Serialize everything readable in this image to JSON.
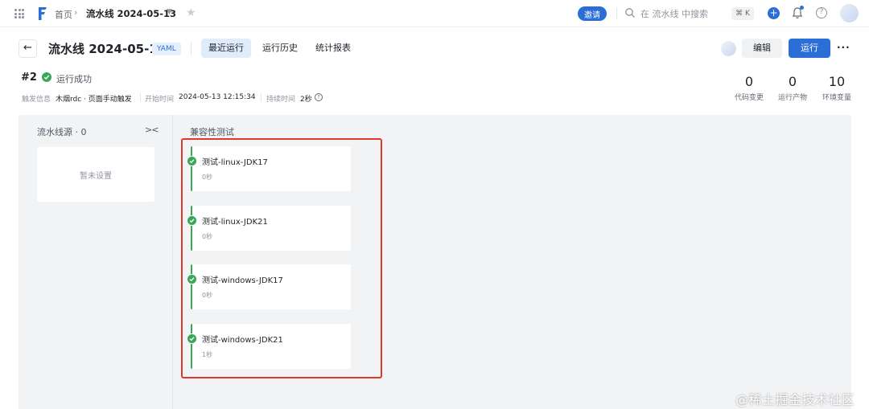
{
  "topbar": {
    "breadcrumb_home": "首页",
    "breadcrumb_sep": "›",
    "breadcrumb_current": "流水线 2024-05-13",
    "invite_label": "邀请",
    "search_placeholder": "在 流水线 中搜索",
    "shortcut": "⌘ K",
    "plus_label": "+",
    "help_label": "?",
    "brand_color": "#2b6fd6"
  },
  "header": {
    "back_label": "←",
    "title": "流水线 2024-05-13",
    "badge": "YAML",
    "tabs": [
      {
        "label": "最近运行",
        "active": true
      },
      {
        "label": "运行历史",
        "active": false
      },
      {
        "label": "统计报表",
        "active": false
      }
    ],
    "edit_label": "编辑",
    "run_label": "运行",
    "more_label": "···"
  },
  "run": {
    "number": "#2",
    "status": "运行成功",
    "status_color": "#3aa657",
    "trigger_label": "触发信息",
    "trigger_value": "木烟rdc · 页面手动触发",
    "start_label": "开始时间",
    "start_value": "2024-05-13 12:15:34",
    "duration_label": "持续时间",
    "duration_value": "2秒",
    "info_label": "?",
    "stats": [
      {
        "value": "0",
        "label": "代码变更"
      },
      {
        "value": "0",
        "label": "运行产物"
      },
      {
        "value": "10",
        "label": "环境变量"
      }
    ]
  },
  "pipeline": {
    "source_title": "流水线源 · 0",
    "collapse_label": "><",
    "source_empty": "暂未设置",
    "stage_title": "兼容性测试",
    "jobs": [
      {
        "name": "测试-linux-JDK17",
        "duration": "0秒"
      },
      {
        "name": "测试-linux-JDK21",
        "duration": "0秒"
      },
      {
        "name": "测试-windows-JDK17",
        "duration": "0秒"
      },
      {
        "name": "测试-windows-JDK21",
        "duration": "1秒"
      }
    ],
    "highlight_color": "#e0392b"
  },
  "watermark": "@稀土掘金技术社区"
}
